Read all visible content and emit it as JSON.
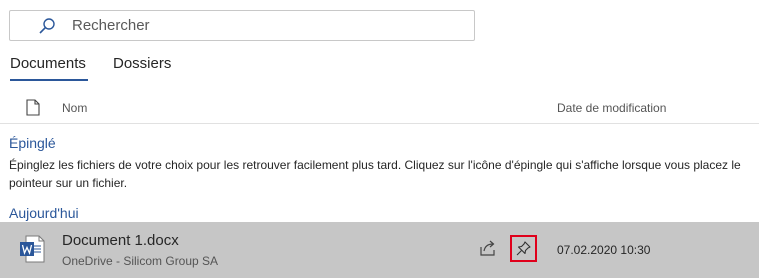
{
  "search": {
    "placeholder": "Rechercher",
    "icon": "search-icon"
  },
  "tabs": [
    {
      "label": "Documents",
      "selected": true
    },
    {
      "label": "Dossiers",
      "selected": false
    }
  ],
  "columns": {
    "name": "Nom",
    "date": "Date de modification"
  },
  "pinned": {
    "title": "Épinglé",
    "description": "Épinglez les fichiers de votre choix pour les retrouver facilement plus tard. Cliquez sur l'icône d'épingle qui s'affiche lorsque vous placez le pointeur sur un fichier."
  },
  "today": {
    "title": "Aujourd'hui",
    "files": [
      {
        "name": "Document 1.docx",
        "location": "OneDrive - Silicom Group SA",
        "modified": "07.02.2020 10:30",
        "icon": "word-file-icon"
      }
    ]
  },
  "colors": {
    "accent": "#2b579a",
    "selected_row": "#c6c6c6",
    "highlight_border": "#e0001b"
  }
}
